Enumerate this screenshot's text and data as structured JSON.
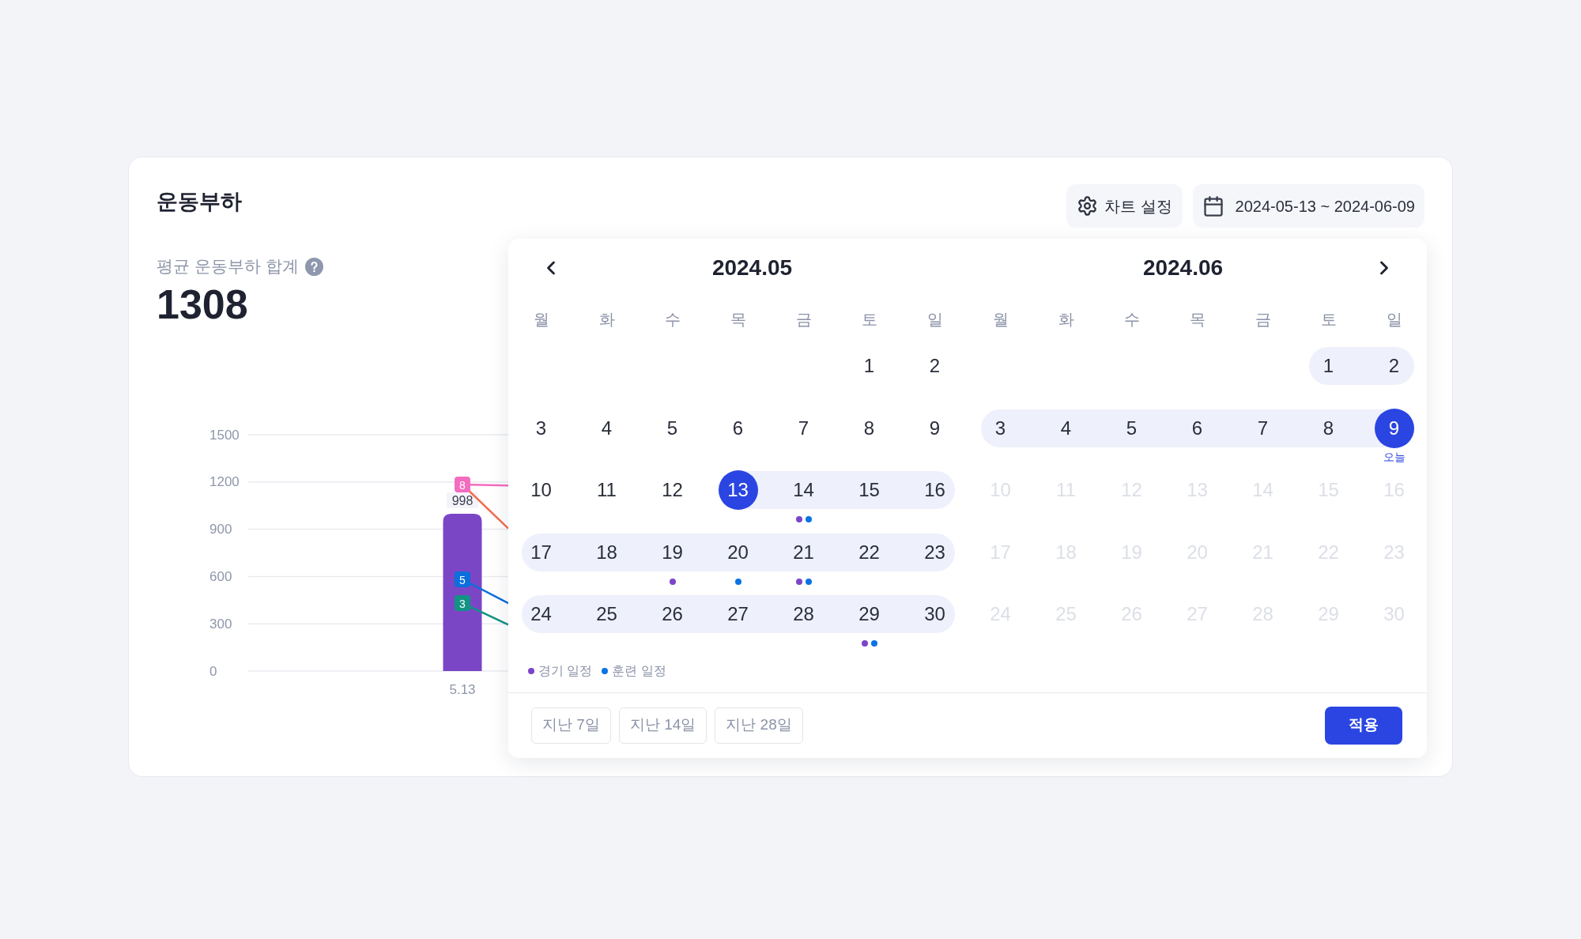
{
  "panel": {
    "title": "운동부하",
    "chart_settings_button": {
      "label": "차트 설정"
    },
    "date_range_button": {
      "label": "2024-05-13 ~ 2024-06-09"
    }
  },
  "summary": {
    "label": "평균 운동부하 합계",
    "value": "1308"
  },
  "chart": {
    "chart_data": {
      "type": "bar",
      "categories": [
        "5.13",
        null
      ],
      "values": [
        998,
        null
      ],
      "color": "#7b46c6",
      "value_labels": [
        "998",
        null
      ],
      "ylim": [
        0,
        1500
      ],
      "yticks": [
        0,
        300,
        600,
        900,
        1200,
        1500
      ],
      "grid": true
    },
    "overlay_lines": [
      {
        "color": "#f36cbf",
        "badge": "8"
      },
      {
        "color": "#f26d50"
      },
      {
        "color": "#0b6fdc",
        "badge": "5"
      },
      {
        "color": "#129384",
        "badge": "3"
      }
    ]
  },
  "date_picker": {
    "months": [
      {
        "title": "2024.05",
        "weekdays": [
          "월",
          "화",
          "수",
          "목",
          "금",
          "토",
          "일"
        ],
        "weeks": [
          {
            "kind": "partial",
            "days": [
              {
                "label": "1",
                "selected": false,
                "in_range": false,
                "disabled": false
              },
              {
                "label": "2",
                "selected": false,
                "in_range": false,
                "disabled": false
              }
            ]
          },
          {
            "kind": "full",
            "days": [
              {
                "label": "3",
                "selected": false,
                "in_range": false,
                "disabled": false
              },
              {
                "label": "4",
                "selected": false,
                "in_range": false,
                "disabled": false
              },
              {
                "label": "5",
                "selected": false,
                "in_range": false,
                "disabled": false
              },
              {
                "label": "6",
                "selected": false,
                "in_range": false,
                "disabled": false
              },
              {
                "label": "7",
                "selected": false,
                "in_range": false,
                "disabled": false
              },
              {
                "label": "8",
                "selected": false,
                "in_range": false,
                "disabled": false
              },
              {
                "label": "9",
                "selected": false,
                "in_range": false,
                "disabled": false
              }
            ]
          },
          {
            "kind": "full",
            "days": [
              {
                "label": "10",
                "selected": false,
                "in_range": false,
                "disabled": false
              },
              {
                "label": "11",
                "selected": false,
                "in_range": false,
                "disabled": false
              },
              {
                "label": "12",
                "selected": false,
                "in_range": false,
                "disabled": false
              },
              {
                "label": "13",
                "selected": true,
                "in_range": true,
                "disabled": false
              },
              {
                "label": "14",
                "selected": false,
                "in_range": true,
                "disabled": false,
                "events": [
                  {
                    "color": "#7b45c8"
                  },
                  {
                    "color": "#0b74e3"
                  }
                ]
              },
              {
                "label": "15",
                "selected": false,
                "in_range": true,
                "disabled": false
              },
              {
                "label": "16",
                "selected": false,
                "in_range": true,
                "disabled": false
              }
            ]
          },
          {
            "kind": "full",
            "days": [
              {
                "label": "17",
                "selected": false,
                "in_range": true,
                "disabled": false
              },
              {
                "label": "18",
                "selected": false,
                "in_range": true,
                "disabled": false
              },
              {
                "label": "19",
                "selected": false,
                "in_range": true,
                "disabled": false,
                "events": [
                  {
                    "color": "#7b45c8"
                  }
                ]
              },
              {
                "label": "20",
                "selected": false,
                "in_range": true,
                "disabled": false,
                "events": [
                  {
                    "color": "#0b74e3"
                  }
                ]
              },
              {
                "label": "21",
                "selected": false,
                "in_range": true,
                "disabled": false,
                "events": [
                  {
                    "color": "#7b45c8"
                  },
                  {
                    "color": "#0b74e3"
                  }
                ]
              },
              {
                "label": "22",
                "selected": false,
                "in_range": true,
                "disabled": false
              },
              {
                "label": "23",
                "selected": false,
                "in_range": true,
                "disabled": false
              }
            ]
          },
          {
            "kind": "full",
            "days": [
              {
                "label": "24",
                "selected": false,
                "in_range": true,
                "disabled": false
              },
              {
                "label": "25",
                "selected": false,
                "in_range": true,
                "disabled": false
              },
              {
                "label": "26",
                "selected": false,
                "in_range": true,
                "disabled": false
              },
              {
                "label": "27",
                "selected": false,
                "in_range": true,
                "disabled": false
              },
              {
                "label": "28",
                "selected": false,
                "in_range": true,
                "disabled": false
              },
              {
                "label": "29",
                "selected": false,
                "in_range": true,
                "disabled": false,
                "events": [
                  {
                    "color": "#7b45c8"
                  },
                  {
                    "color": "#0b74e3"
                  }
                ]
              },
              {
                "label": "30",
                "selected": false,
                "in_range": true,
                "disabled": false
              }
            ]
          }
        ]
      },
      {
        "title": "2024.06",
        "weekdays": [
          "월",
          "화",
          "수",
          "목",
          "금",
          "토",
          "일"
        ],
        "weeks": [
          {
            "kind": "partial",
            "days": [
              {
                "label": "1",
                "selected": false,
                "in_range": true,
                "disabled": false
              },
              {
                "label": "2",
                "selected": false,
                "in_range": true,
                "disabled": false
              }
            ]
          },
          {
            "kind": "full",
            "days": [
              {
                "label": "3",
                "selected": false,
                "in_range": true,
                "disabled": false
              },
              {
                "label": "4",
                "selected": false,
                "in_range": true,
                "disabled": false
              },
              {
                "label": "5",
                "selected": false,
                "in_range": true,
                "disabled": false
              },
              {
                "label": "6",
                "selected": false,
                "in_range": true,
                "disabled": false
              },
              {
                "label": "7",
                "selected": false,
                "in_range": true,
                "disabled": false
              },
              {
                "label": "8",
                "selected": false,
                "in_range": true,
                "disabled": false
              },
              {
                "label": "9",
                "selected": true,
                "in_range": true,
                "disabled": false,
                "note": "오늘"
              }
            ]
          },
          {
            "kind": "full",
            "days": [
              {
                "label": "10",
                "selected": false,
                "in_range": false,
                "disabled": true
              },
              {
                "label": "11",
                "selected": false,
                "in_range": false,
                "disabled": true
              },
              {
                "label": "12",
                "selected": false,
                "in_range": false,
                "disabled": true
              },
              {
                "label": "13",
                "selected": false,
                "in_range": false,
                "disabled": true
              },
              {
                "label": "14",
                "selected": false,
                "in_range": false,
                "disabled": true
              },
              {
                "label": "15",
                "selected": false,
                "in_range": false,
                "disabled": true
              },
              {
                "label": "16",
                "selected": false,
                "in_range": false,
                "disabled": true
              }
            ]
          },
          {
            "kind": "full",
            "days": [
              {
                "label": "17",
                "selected": false,
                "in_range": false,
                "disabled": true
              },
              {
                "label": "18",
                "selected": false,
                "in_range": false,
                "disabled": true
              },
              {
                "label": "19",
                "selected": false,
                "in_range": false,
                "disabled": true
              },
              {
                "label": "20",
                "selected": false,
                "in_range": false,
                "disabled": true
              },
              {
                "label": "21",
                "selected": false,
                "in_range": false,
                "disabled": true
              },
              {
                "label": "22",
                "selected": false,
                "in_range": false,
                "disabled": true
              },
              {
                "label": "23",
                "selected": false,
                "in_range": false,
                "disabled": true
              }
            ]
          },
          {
            "kind": "full",
            "days": [
              {
                "label": "24",
                "selected": false,
                "in_range": false,
                "disabled": true
              },
              {
                "label": "25",
                "selected": false,
                "in_range": false,
                "disabled": true
              },
              {
                "label": "26",
                "selected": false,
                "in_range": false,
                "disabled": true
              },
              {
                "label": "27",
                "selected": false,
                "in_range": false,
                "disabled": true
              },
              {
                "label": "28",
                "selected": false,
                "in_range": false,
                "disabled": true
              },
              {
                "label": "29",
                "selected": false,
                "in_range": false,
                "disabled": true
              },
              {
                "label": "30",
                "selected": false,
                "in_range": false,
                "disabled": true
              }
            ]
          }
        ]
      }
    ],
    "legend": [
      {
        "label": "경기 일정",
        "color": "#7b45c8"
      },
      {
        "label": "훈련 일정",
        "color": "#0b74e3"
      }
    ],
    "presets": [
      {
        "label": "지난 7일",
        "selected": false
      },
      {
        "label": "지난 14일",
        "selected": false
      },
      {
        "label": "지난 28일",
        "selected": false
      }
    ],
    "apply_button": {
      "label": "적용"
    }
  }
}
